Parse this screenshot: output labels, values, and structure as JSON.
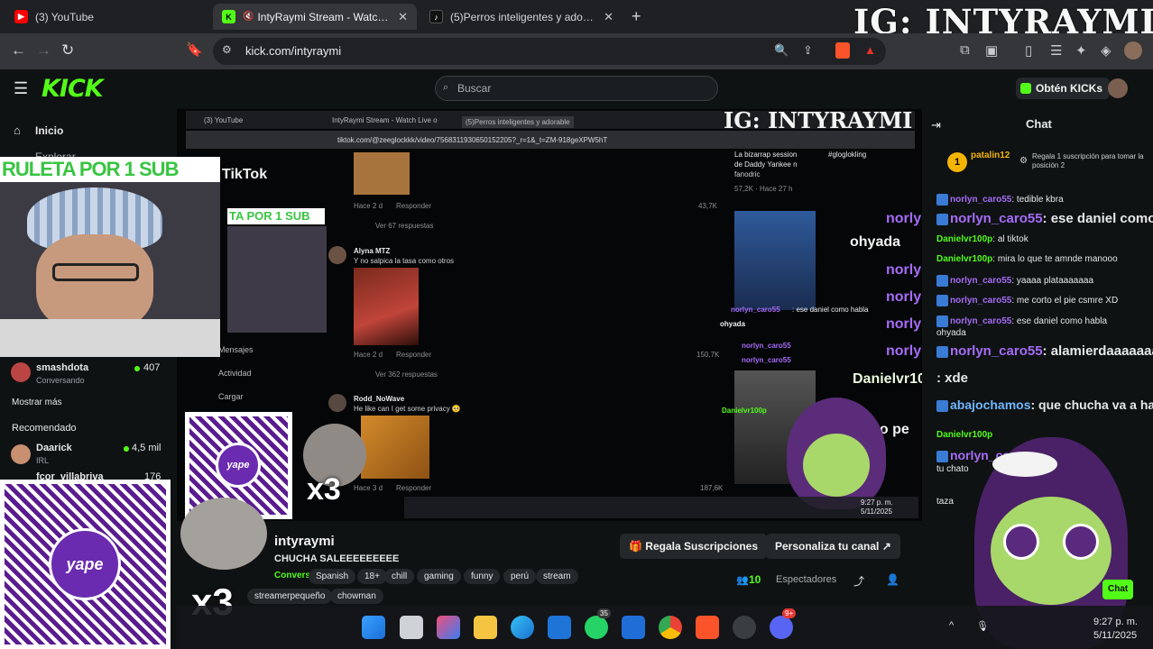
{
  "browser": {
    "tabs": [
      {
        "title": "(3) YouTube",
        "favicon": "youtube-icon"
      },
      {
        "title": "IntyRaymi Stream - Watch Live on Kick",
        "favicon": "kick-icon",
        "active": true
      },
      {
        "title": "(5)Perros inteligentes y adorables",
        "favicon": "tiktok-icon"
      }
    ],
    "url": "kick.com/intyraymi"
  },
  "overlay_ig": "IG: INTYRAYMI",
  "kick": {
    "logo": "KICK",
    "search_placeholder": "Buscar",
    "get_kicks": "Obtén KICKs"
  },
  "sidebar": {
    "home": "Inicio",
    "explore": "Explorar",
    "following_user": {
      "name": "smashdota",
      "status": "Conversando",
      "viewers": "407"
    },
    "show_more": "Mostrar más",
    "recommended_title": "Recomendado",
    "recommended": [
      {
        "name": "Daarick",
        "category": "IRL",
        "viewers": "4,5 mil"
      },
      {
        "name": "fcor_villabriva",
        "viewers": "176"
      }
    ]
  },
  "webcam_banner": "RULETA POR 1 SUB",
  "inner_browser": {
    "tabs": [
      "(3) YouTube",
      "IntyRaymi Stream - Watch Live o",
      "(5)Perros inteligentes y adorable"
    ],
    "url": "tiktok.com/@zeeglockkk/video/7568311930650152205?_r=1&_t=ZM-918geXPW5hT",
    "ig": "IG: INTYRAYMI",
    "tiktok_label": "TikTok",
    "ruleta_small": "TA POR 1 SUB",
    "side_items": [
      "Mensajes",
      "Actividad",
      "Cargar"
    ],
    "comments": [
      {
        "meta": "Hace 2 d",
        "reply": "Responder",
        "likes": "43,7K"
      },
      {
        "replies": "Ver 67 respuestas"
      },
      {
        "name": "Alyna MTZ",
        "text": "Y no salpica la tasa como otros"
      },
      {
        "meta": "Hace 2 d",
        "reply": "Responder",
        "likes": "150,7K"
      },
      {
        "replies": "Ver 362 respuestas"
      },
      {
        "name": "Rodd_NoWave",
        "text": "He like can I get some privacy 🥺"
      },
      {
        "meta": "Hace 3 d",
        "reply": "Responder",
        "likes": "187,6K"
      }
    ],
    "video_desc": [
      "La bizarrap session",
      "de Daddy Yankee n",
      "fanodric"
    ],
    "video_tag": "#gloglokling",
    "video_stats": "57,2K · Hace 27 h",
    "chat_small": [
      {
        "name": "norlyn_caro55",
        "text": ": ese daniel como habla"
      },
      {
        "name": "",
        "text": "ohyada"
      },
      {
        "name": "norlyn_caro55",
        "text": ""
      },
      {
        "name": "norlyn_caro55",
        "text": ""
      },
      {
        "name": "Danielvr100p",
        "text": ""
      }
    ],
    "taskbar_time": "9:27 p. m.",
    "taskbar_date": "5/11/2025"
  },
  "x3_label": "x3",
  "channel": {
    "name": "intyraymi",
    "title": "CHUCHA SALEEEEEEEEE",
    "live_label": "Conversando",
    "tags": [
      "Spanish",
      "18+",
      "chill",
      "gaming",
      "funny",
      "perú",
      "stream",
      "streamerpequeño",
      "chowman"
    ],
    "gift_subs": "Regala Suscripciones",
    "customize": "Personaliza tu canal",
    "viewers": "10",
    "viewers_label": "Espectadores"
  },
  "chat": {
    "title": "Chat",
    "pinned_user": "patalin12",
    "pinned_rank": "1",
    "pinned_hint": "Regala 1 suscripción para tomar la posición 2",
    "messages": [
      {
        "user": "norlyn_caro55",
        "color": "#a56cf7",
        "text": ": tedible kbra"
      },
      {
        "user": "norlyn_caro55",
        "color": "#a56cf7",
        "text": ": ese daniel como habla",
        "big": true
      },
      {
        "user": "Danielvr100p",
        "color": "#53fc18",
        "text": ": al tiktok"
      },
      {
        "user": "Danielvr100p",
        "color": "#53fc18",
        "text": ": mira lo que te amnde manooo"
      },
      {
        "user": "norlyn_caro55",
        "color": "#a56cf7",
        "text": ": yaaaa plataaaaaaa"
      },
      {
        "user": "norlyn_caro55",
        "color": "#a56cf7",
        "text": ": me corto el pie csmre XD"
      },
      {
        "user": "norlyn_caro55",
        "color": "#a56cf7",
        "text": ": ese daniel como habla"
      },
      {
        "user": "",
        "color": "#e6e8ea",
        "text": "ohyada"
      },
      {
        "user": "norlyn_caro55",
        "color": "#a56cf7",
        "text": ": alamierdaaaaaaaaa",
        "big": true
      },
      {
        "user": "Danielvr100p",
        "color": "#53fc18",
        "text": ": xde",
        "big": true
      },
      {
        "user": "abajochamos",
        "color": "#6fb7ff",
        "text": ": que chucha va a hacer es",
        "big": true
      },
      {
        "user": "norlyn_caro55",
        "color": "#a56cf7",
        "text": ": alamierdaaaaaaaaa"
      },
      {
        "user": "Danielvr100p",
        "color": "#53fc18",
        "text": ": chato pe"
      },
      {
        "user": "norlyn_caro55",
        "color": "#a56cf7",
        "text": ": alamierdaaaaaaa",
        "big": true
      },
      {
        "user": "",
        "color": "#e6e8ea",
        "text": "tu chato"
      },
      {
        "user": "",
        "color": "#e6e8ea",
        "text": "taza"
      }
    ],
    "overlay_texts": [
      "ohyada",
      "chato pe",
      "taza"
    ],
    "chat_button": "Chat"
  },
  "windows_taskbar": {
    "time": "9:27 p. m.",
    "date": "5/11/2025",
    "whatsapp_badge": "35",
    "discord_badge": "9+"
  },
  "colors": {
    "kick_green": "#53fc18",
    "purple_name": "#a56cf7",
    "background": "#0b0e0f"
  }
}
